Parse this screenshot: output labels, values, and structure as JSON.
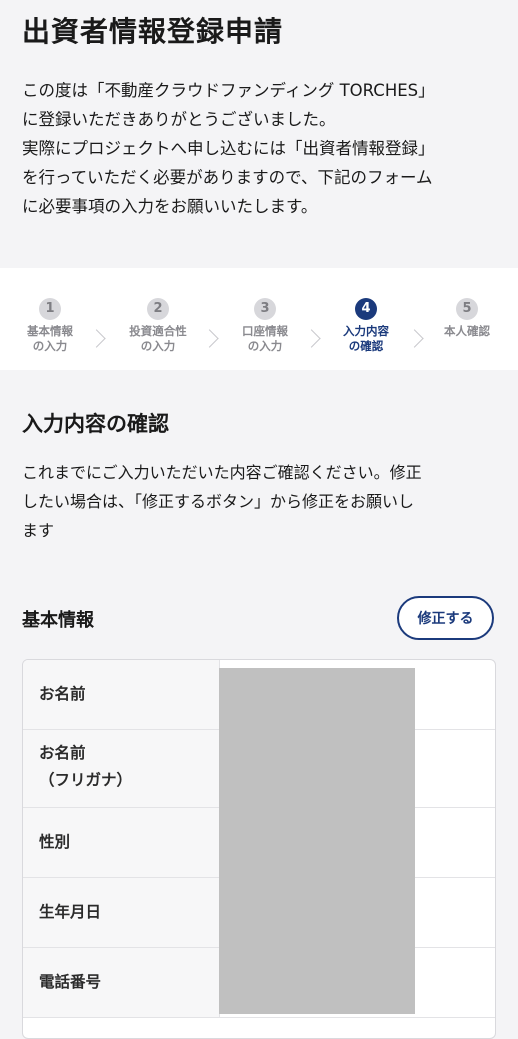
{
  "page": {
    "title": "出資者情報登録申請",
    "intro_lines": [
      "この度は「不動産クラウドファンディング TORCHES」",
      "に登録いただきありがとうございました。",
      "実際にプロジェクトへ申し込むには「出資者情報登録」",
      "を行っていただく必要がありますので、下記のフォーム",
      "に必要事項の入力をお願いいたします。"
    ]
  },
  "stepper": {
    "active_step": 4,
    "steps": [
      {
        "num": "1",
        "label": "基本情報\nの入力"
      },
      {
        "num": "2",
        "label": "投資適合性\nの入力"
      },
      {
        "num": "3",
        "label": "口座情報\nの入力"
      },
      {
        "num": "4",
        "label": "入力内容\nの確認"
      },
      {
        "num": "5",
        "label": "本人確認"
      }
    ]
  },
  "confirm": {
    "title": "入力内容の確認",
    "desc_lines": [
      "これまでにご入力いただいた内容ご確認ください。修正",
      "したい場合は、「修正するボタン」から修正をお願いし",
      "ます"
    ]
  },
  "basic_info": {
    "title": "基本情報",
    "edit_label": "修正する",
    "rows": [
      {
        "label": "お名前"
      },
      {
        "label": "お名前\n（フリガナ）"
      },
      {
        "label": "性別"
      },
      {
        "label": "生年月日"
      },
      {
        "label": "電話番号"
      }
    ]
  },
  "colors": {
    "accent": "#1b3a7c",
    "inactive_step": "#d7d7db",
    "background": "#f4f4f6",
    "redaction": "#c0c0c0"
  }
}
